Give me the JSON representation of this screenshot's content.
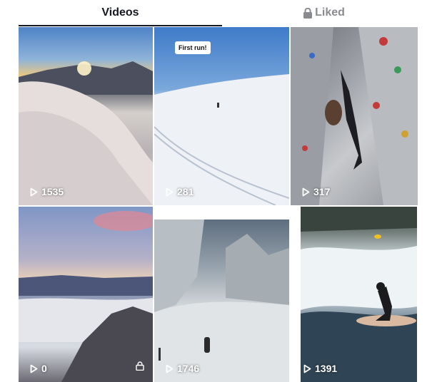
{
  "tabs": {
    "videos_label": "Videos",
    "liked_label": "Liked"
  },
  "videos": [
    {
      "views": "1535",
      "scene": "snowy-sunrise"
    },
    {
      "views": "281",
      "scene": "snow-slope",
      "caption": "First run!"
    },
    {
      "views": "317",
      "scene": "climbing-wall"
    },
    {
      "views": "0",
      "scene": "sea-of-clouds",
      "private": true
    },
    {
      "views": "1746",
      "scene": "snowy-forest"
    },
    {
      "views": "1391",
      "scene": "river-surfing"
    }
  ],
  "colors": {
    "active_tab": "#161823",
    "inactive_tab": "#8a8b91"
  }
}
